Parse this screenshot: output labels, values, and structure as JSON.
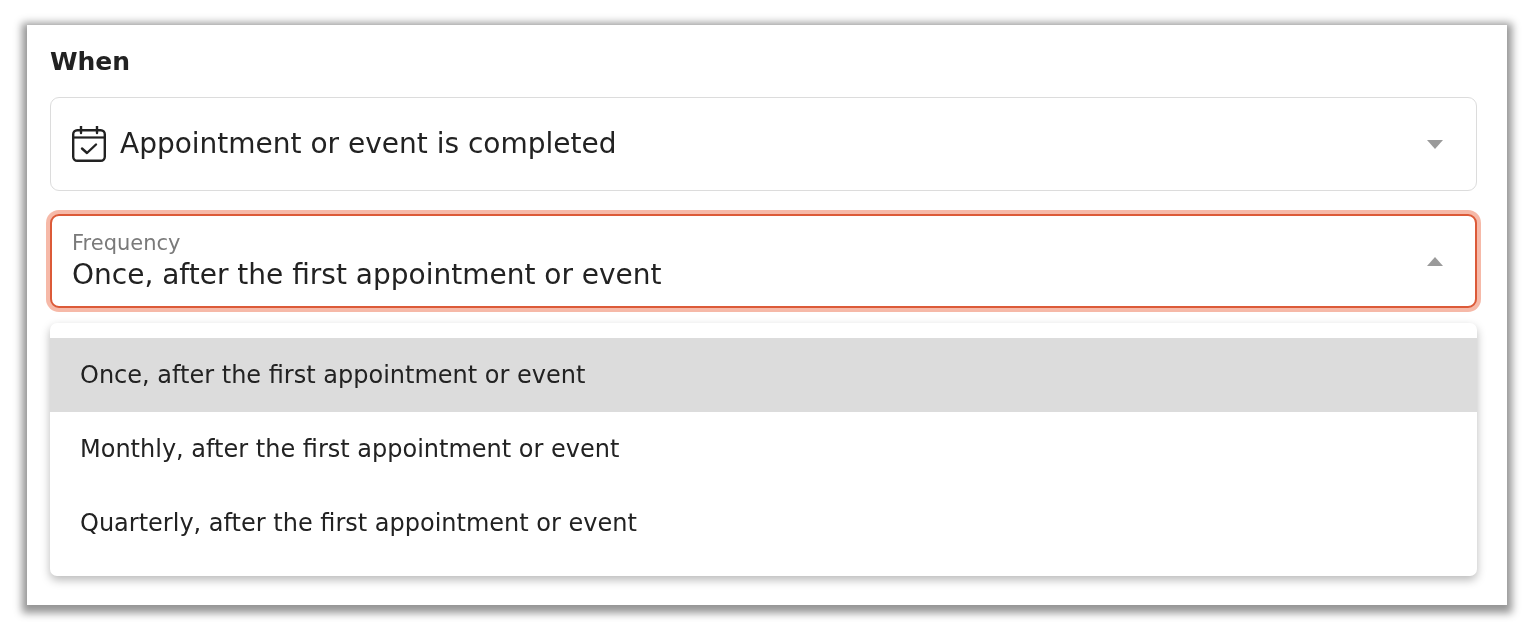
{
  "heading": "When",
  "trigger_select": {
    "value": "Appointment or event is completed",
    "expanded": false,
    "focused": false
  },
  "frequency_select": {
    "label": "Frequency",
    "value": "Once, after the first appointment or event",
    "expanded": true,
    "focused": true
  },
  "frequency_options": [
    {
      "label": "Once, after the first appointment or event",
      "selected": true
    },
    {
      "label": "Monthly, after the first appointment or event",
      "selected": false
    },
    {
      "label": "Quarterly, after the first appointment or event",
      "selected": false
    }
  ]
}
